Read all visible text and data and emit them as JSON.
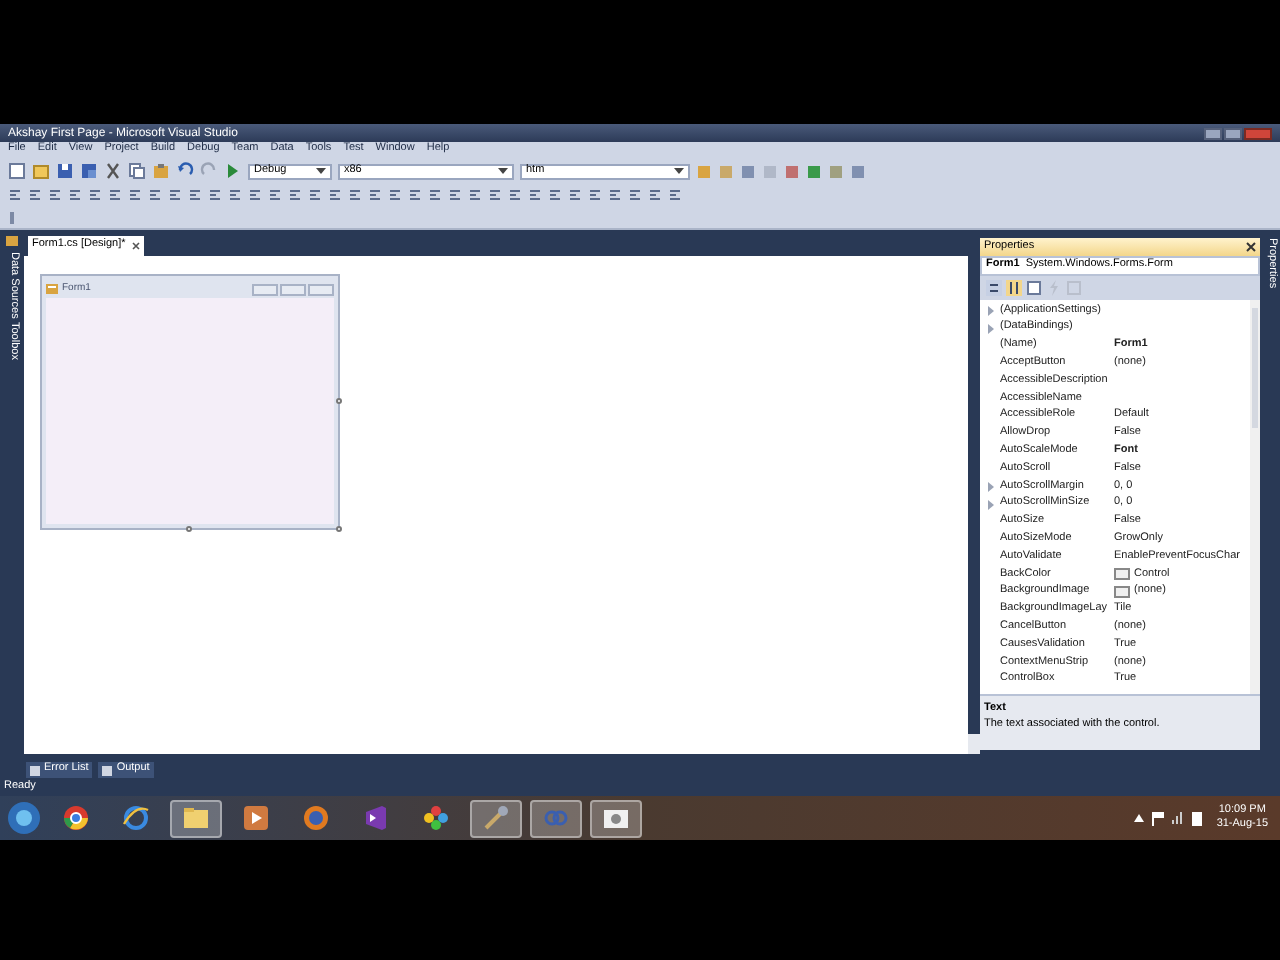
{
  "window": {
    "title": "Akshay First Page - Microsoft Visual Studio"
  },
  "menu": [
    "File",
    "Edit",
    "View",
    "Project",
    "Build",
    "Debug",
    "Team",
    "Data",
    "Tools",
    "Test",
    "Window",
    "Help"
  ],
  "toolbar": {
    "configuration": "Debug",
    "platform": "x86",
    "find": "htm"
  },
  "left_side_tabs": [
    "Data Sources",
    "Toolbox"
  ],
  "document_tabs": [
    {
      "label": "Form1.cs [Design]*",
      "selected": true
    }
  ],
  "form": {
    "title": "Form1"
  },
  "properties": {
    "title": "Properties",
    "object": "Form1",
    "type": "System.Windows.Forms.Form",
    "rows": [
      {
        "name": "(ApplicationSettings)",
        "expandable": true
      },
      {
        "name": "(DataBindings)",
        "expandable": true
      },
      {
        "name": "(Name)",
        "value": "Form1",
        "bold": true
      },
      {
        "name": "AcceptButton",
        "value": "(none)"
      },
      {
        "name": "AccessibleDescription"
      },
      {
        "name": "AccessibleName"
      },
      {
        "name": "AccessibleRole",
        "value": "Default"
      },
      {
        "name": "AllowDrop",
        "value": "False"
      },
      {
        "name": "AutoScaleMode",
        "value": "Font",
        "bold": true
      },
      {
        "name": "AutoScroll",
        "value": "False"
      },
      {
        "name": "AutoScrollMargin",
        "value": "0, 0",
        "expandable": true
      },
      {
        "name": "AutoScrollMinSize",
        "value": "0, 0",
        "expandable": true
      },
      {
        "name": "AutoSize",
        "value": "False"
      },
      {
        "name": "AutoSizeMode",
        "value": "GrowOnly"
      },
      {
        "name": "AutoValidate",
        "value": "EnablePreventFocusChar"
      },
      {
        "name": "BackColor",
        "value": "Control",
        "swatch": true
      },
      {
        "name": "BackgroundImage",
        "value": "(none)",
        "swatch": true
      },
      {
        "name": "BackgroundImageLay",
        "value": "Tile"
      },
      {
        "name": "CancelButton",
        "value": "(none)"
      },
      {
        "name": "CausesValidation",
        "value": "True"
      },
      {
        "name": "ContextMenuStrip",
        "value": "(none)"
      },
      {
        "name": "ControlBox",
        "value": "True"
      }
    ],
    "description": {
      "title": "Text",
      "text": "The text associated with the control."
    }
  },
  "right_side_tabs": [
    "Properties"
  ],
  "bottom_tabs": [
    "Error List",
    "Output"
  ],
  "status": "Ready",
  "taskbar": {
    "apps": [
      {
        "kind": "chrome",
        "running": false
      },
      {
        "kind": "ie",
        "running": false
      },
      {
        "kind": "folder",
        "running": true
      },
      {
        "kind": "media",
        "running": false
      },
      {
        "kind": "firefox",
        "running": false
      },
      {
        "kind": "vs",
        "running": false
      },
      {
        "kind": "flower",
        "running": false
      },
      {
        "kind": "tools",
        "running": true
      },
      {
        "kind": "link",
        "running": true
      },
      {
        "kind": "camera",
        "running": true
      }
    ],
    "time": "10:09 PM",
    "date": "31-Aug-15"
  }
}
